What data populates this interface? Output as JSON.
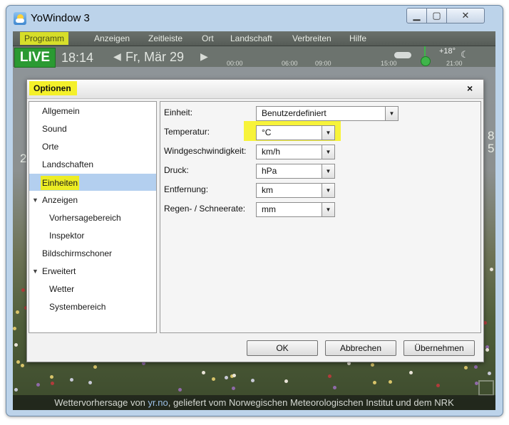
{
  "window": {
    "title": "YoWindow 3",
    "min_glyph": "▁",
    "max_glyph": "▢",
    "close_glyph": "✕"
  },
  "menu": [
    "Programm",
    "Anzeigen",
    "Zeitleiste",
    "Ort",
    "Landschaft",
    "Verbreiten",
    "Hilfe"
  ],
  "toolbar": {
    "live": "LIVE",
    "time": "18:14",
    "date": "Fr, Mär 29",
    "prev_glyph": "◀",
    "next_glyph": "▶",
    "timeline_ticks": [
      "00:00",
      "06:00",
      "09:00",
      "15:00",
      "21:00"
    ],
    "timeline_temp": "+18°"
  },
  "background": {
    "left_value": "26",
    "right_value_1": "8",
    "right_value_2": "5",
    "credit_prefix": "Wettervorhersage von ",
    "credit_link": "yr.no",
    "credit_suffix": ", geliefert vom Norwegischen Meteorologischen Institut und dem NRK"
  },
  "dialog": {
    "title": "Optionen",
    "close_glyph": "×",
    "tree": [
      {
        "label": "Allgemein",
        "indent": 0
      },
      {
        "label": "Sound",
        "indent": 0
      },
      {
        "label": "Orte",
        "indent": 0
      },
      {
        "label": "Landschaften",
        "indent": 0
      },
      {
        "label": "Einheiten",
        "indent": 0,
        "selected": true
      },
      {
        "label": "Anzeigen",
        "indent": 0,
        "expanded": true
      },
      {
        "label": "Vorhersagebereich",
        "indent": 1
      },
      {
        "label": "Inspektor",
        "indent": 1
      },
      {
        "label": "Bildschirmschoner",
        "indent": 0
      },
      {
        "label": "Erweitert",
        "indent": 0,
        "expanded": true
      },
      {
        "label": "Wetter",
        "indent": 1
      },
      {
        "label": "Systembereich",
        "indent": 1
      }
    ],
    "settings": [
      {
        "label": "Einheit:",
        "value": "Benutzerdefiniert"
      },
      {
        "label": "Temperatur:",
        "value": "°C"
      },
      {
        "label": "Windgeschwindigkeit:",
        "value": "km/h"
      },
      {
        "label": "Druck:",
        "value": "hPa"
      },
      {
        "label": "Entfernung:",
        "value": "km"
      },
      {
        "label": "Regen- / Schneerate:",
        "value": "mm"
      }
    ],
    "buttons": {
      "ok": "OK",
      "cancel": "Abbrechen",
      "apply": "Übernehmen"
    }
  },
  "colors": {
    "highlight": "#f4f02a",
    "selection": "#b3cfef",
    "live": "#2b9a32"
  }
}
